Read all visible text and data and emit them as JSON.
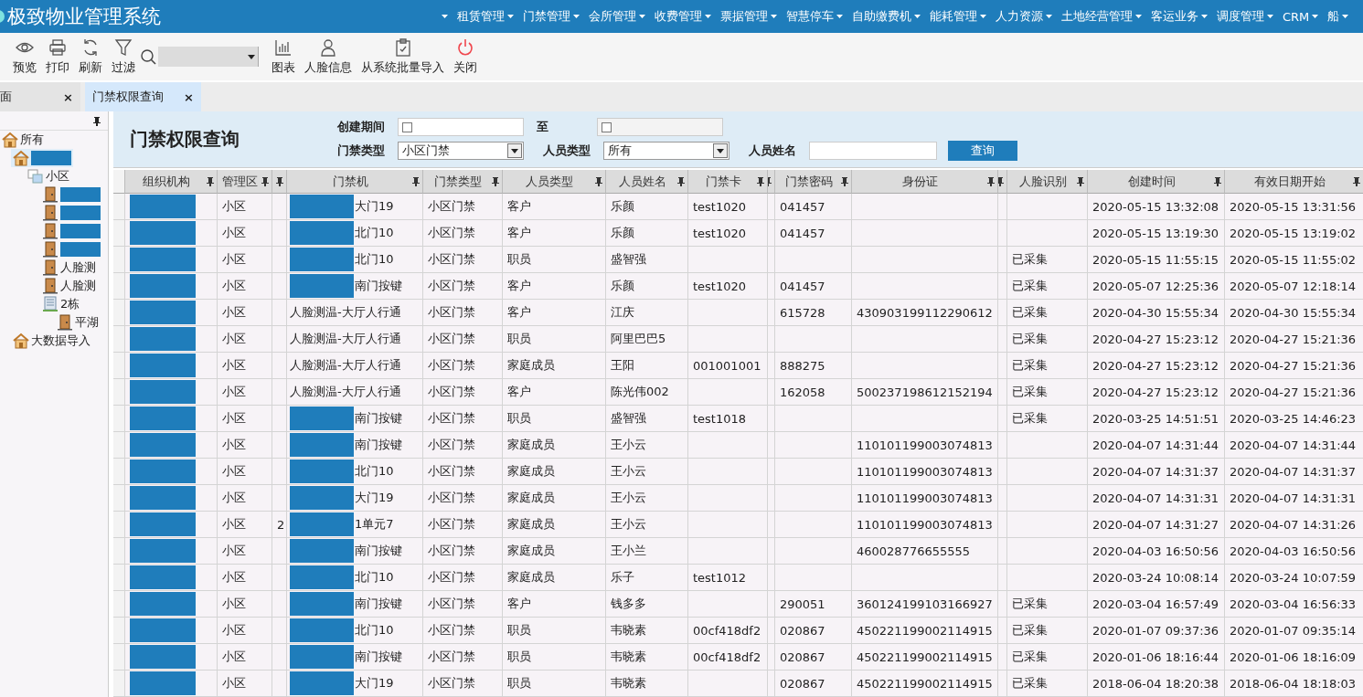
{
  "app": {
    "title": "极致物业管理系统"
  },
  "menu": [
    {
      "label": "租赁管理"
    },
    {
      "label": "门禁管理"
    },
    {
      "label": "会所管理"
    },
    {
      "label": "收费管理"
    },
    {
      "label": "票据管理"
    },
    {
      "label": "智慧停车"
    },
    {
      "label": "自助缴费机"
    },
    {
      "label": "能耗管理"
    },
    {
      "label": "人力资源"
    },
    {
      "label": "土地经营管理"
    },
    {
      "label": "客运业务"
    },
    {
      "label": "调度管理"
    },
    {
      "label": "CRM"
    },
    {
      "label": "船"
    }
  ],
  "toolbar": [
    {
      "label": "预览",
      "kind": "eye"
    },
    {
      "label": "打印",
      "kind": "printer"
    },
    {
      "label": "刷新",
      "kind": "refresh"
    },
    {
      "label": "过滤",
      "kind": "filter"
    },
    {
      "kind": "search"
    },
    {
      "label": "图表",
      "kind": "chart"
    },
    {
      "label": "人脸信息",
      "kind": "person"
    },
    {
      "label": "从系统批量导入",
      "kind": "import"
    },
    {
      "label": "关闭",
      "kind": "power"
    }
  ],
  "tabs": [
    {
      "label": "面",
      "close": "×",
      "selected": false
    },
    {
      "label": "门禁权限查询",
      "close": "×",
      "selected": true
    }
  ],
  "tree": [
    {
      "label": "所有",
      "kind": "home",
      "selected": false,
      "children": [
        {
          "kind": "home",
          "redacted": true,
          "selected": true,
          "children": [
            {
              "label": "小区",
              "kind": "group",
              "selected": false,
              "children": [
                {
                  "kind": "door",
                  "redacted": true,
                  "selected": false
                },
                {
                  "kind": "door",
                  "redacted": true,
                  "selected": false
                },
                {
                  "kind": "door",
                  "redacted": true,
                  "selected": false
                },
                {
                  "kind": "door",
                  "redacted": true,
                  "selected": false
                },
                {
                  "label": "人脸测",
                  "kind": "door",
                  "selected": false
                },
                {
                  "label": "人脸测",
                  "kind": "door",
                  "selected": false
                },
                {
                  "label": "2栋",
                  "kind": "building",
                  "selected": false,
                  "children": [
                    {
                      "label": "平湖",
                      "kind": "door",
                      "selected": false
                    }
                  ]
                }
              ]
            }
          ]
        },
        {
          "label": "大数据导入",
          "kind": "home",
          "selected": false
        }
      ]
    }
  ],
  "query": {
    "title": "门禁权限查询",
    "date_label": "创建期间",
    "to_label": "至",
    "date_from": {
      "checked": false,
      "disabled": false
    },
    "date_to": {
      "checked": false,
      "disabled": true
    },
    "door_type_label": "门禁类型",
    "door_type": "小区门禁",
    "person_type_label": "人员类型",
    "person_type": "所有",
    "name_label": "人员姓名",
    "search_button": "查询"
  },
  "table": {
    "columns": [
      "组织机构",
      "管理区",
      "门禁机",
      "门禁类型",
      "人员类型",
      "人员姓名",
      "门禁卡",
      "门禁密码",
      "身份证",
      "人脸识别",
      "创建时间",
      "有效日期开始"
    ],
    "rows": [
      {
        "area": "小区",
        "door": "大门19",
        "door_redacted": true,
        "door_type": "小区门禁",
        "person_type": "客户",
        "name": "乐颜",
        "card": "test1020",
        "password": "041457",
        "created": "2020-05-15 13:32:08",
        "valid_from": "2020-05-15 13:31:56"
      },
      {
        "area": "小区",
        "door": "北门10",
        "door_redacted": true,
        "door_type": "小区门禁",
        "person_type": "客户",
        "name": "乐颜",
        "card": "test1020",
        "password": "041457",
        "created": "2020-05-15 13:19:30",
        "valid_from": "2020-05-15 13:19:02"
      },
      {
        "area": "小区",
        "door": "北门10",
        "door_redacted": true,
        "door_type": "小区门禁",
        "person_type": "职员",
        "name": "盛智强",
        "face": "已采集",
        "created": "2020-05-15 11:55:15",
        "valid_from": "2020-05-15 11:55:02"
      },
      {
        "area": "小区",
        "door": "南门按键",
        "door_redacted": true,
        "door_type": "小区门禁",
        "person_type": "客户",
        "name": "乐颜",
        "card": "test1020",
        "password": "041457",
        "face": "已采集",
        "created": "2020-05-07 12:25:36",
        "valid_from": "2020-05-07 12:18:14"
      },
      {
        "area": "小区",
        "door": "人脸测温-大厅人行通",
        "door_redacted": false,
        "door_type": "小区门禁",
        "person_type": "客户",
        "name": "江庆",
        "password": "615728",
        "id_card": "430903199112290612",
        "face": "已采集",
        "created": "2020-04-30 15:55:34",
        "valid_from": "2020-04-30 15:55:34"
      },
      {
        "area": "小区",
        "door": "人脸测温-大厅人行通",
        "door_redacted": false,
        "door_type": "小区门禁",
        "person_type": "职员",
        "name": "阿里巴巴5",
        "face": "已采集",
        "created": "2020-04-27 15:23:12",
        "valid_from": "2020-04-27 15:21:36"
      },
      {
        "area": "小区",
        "door": "人脸测温-大厅人行通",
        "door_redacted": false,
        "door_type": "小区门禁",
        "person_type": "家庭成员",
        "name": "王阳",
        "card": "001001001",
        "password": "888275",
        "face": "已采集",
        "created": "2020-04-27 15:23:12",
        "valid_from": "2020-04-27 15:21:36"
      },
      {
        "area": "小区",
        "door": "人脸测温-大厅人行通",
        "door_redacted": false,
        "door_type": "小区门禁",
        "person_type": "客户",
        "name": "陈光伟002",
        "password": "162058",
        "id_card": "500237198612152194",
        "face": "已采集",
        "created": "2020-04-27 15:23:12",
        "valid_from": "2020-04-27 15:21:36"
      },
      {
        "area": "小区",
        "door": "南门按键",
        "door_redacted": true,
        "door_type": "小区门禁",
        "person_type": "职员",
        "name": "盛智强",
        "card": "test1018",
        "face": "已采集",
        "created": "2020-03-25 14:51:51",
        "valid_from": "2020-03-25 14:46:23"
      },
      {
        "area": "小区",
        "door": "南门按键",
        "door_redacted": true,
        "door_type": "小区门禁",
        "person_type": "家庭成员",
        "name": "王小云",
        "id_card": "110101199003074813",
        "created": "2020-04-07 14:31:44",
        "valid_from": "2020-04-07 14:31:44"
      },
      {
        "area": "小区",
        "door": "北门10",
        "door_redacted": true,
        "door_type": "小区门禁",
        "person_type": "家庭成员",
        "name": "王小云",
        "id_card": "110101199003074813",
        "created": "2020-04-07 14:31:37",
        "valid_from": "2020-04-07 14:31:37"
      },
      {
        "area": "小区",
        "door": "大门19",
        "door_redacted": true,
        "door_type": "小区门禁",
        "person_type": "家庭成员",
        "name": "王小云",
        "id_card": "110101199003074813",
        "created": "2020-04-07 14:31:31",
        "valid_from": "2020-04-07 14:31:31"
      },
      {
        "area": "小区",
        "column_3": "2",
        "door": "1单元7",
        "door_redacted": true,
        "door_type": "小区门禁",
        "person_type": "家庭成员",
        "name": "王小云",
        "id_card": "110101199003074813",
        "created": "2020-04-07 14:31:27",
        "valid_from": "2020-04-07 14:31:26"
      },
      {
        "area": "小区",
        "door": "南门按键",
        "door_redacted": true,
        "door_type": "小区门禁",
        "person_type": "家庭成员",
        "name": "王小兰",
        "id_card": "460028776655555",
        "created": "2020-04-03 16:50:56",
        "valid_from": "2020-04-03 16:50:56"
      },
      {
        "area": "小区",
        "door": "北门10",
        "door_redacted": true,
        "door_type": "小区门禁",
        "person_type": "家庭成员",
        "name": "乐子",
        "card": "test1012",
        "created": "2020-03-24 10:08:14",
        "valid_from": "2020-03-24 10:07:59"
      },
      {
        "area": "小区",
        "door": "南门按键",
        "door_redacted": true,
        "door_type": "小区门禁",
        "person_type": "客户",
        "name": "钱多多",
        "password": "290051",
        "id_card": "360124199103166927",
        "face": "已采集",
        "created": "2020-03-04 16:57:49",
        "valid_from": "2020-03-04 16:56:33"
      },
      {
        "area": "小区",
        "door": "北门10",
        "door_redacted": true,
        "door_type": "小区门禁",
        "person_type": "职员",
        "name": "韦晓素",
        "card": "00cf418df2",
        "password": "020867",
        "id_card": "450221199002114915",
        "face": "已采集",
        "created": "2020-01-07 09:37:36",
        "valid_from": "2020-01-07 09:35:14"
      },
      {
        "area": "小区",
        "door": "南门按键",
        "door_redacted": true,
        "door_type": "小区门禁",
        "person_type": "职员",
        "name": "韦晓素",
        "card": "00cf418df2",
        "password": "020867",
        "id_card": "450221199002114915",
        "face": "已采集",
        "created": "2020-01-06 18:16:44",
        "valid_from": "2020-01-06 18:16:09"
      },
      {
        "area": "小区",
        "door": "大门19",
        "door_redacted": true,
        "door_type": "小区门禁",
        "person_type": "职员",
        "name": "韦晓素",
        "password": "020867",
        "id_card": "450221199002114915",
        "face": "已采集",
        "created": "2018-06-04 18:20:38",
        "valid_from": "2018-06-04 18:18:03"
      }
    ]
  }
}
